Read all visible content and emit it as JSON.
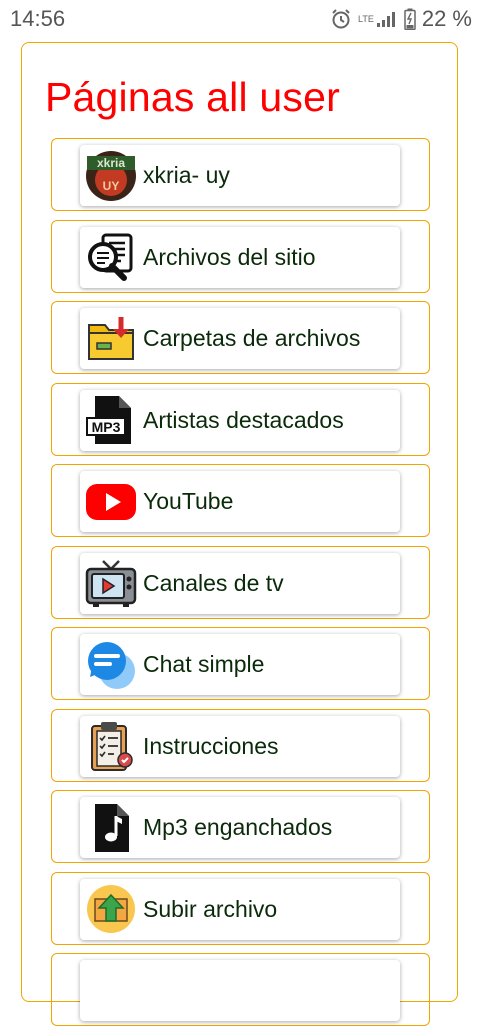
{
  "status_bar": {
    "time": "14:56",
    "network": "LTE",
    "battery": "22 %"
  },
  "page_title": "Páginas all user",
  "menu": [
    {
      "label": "xkria- uy",
      "icon": "xkria-logo-icon"
    },
    {
      "label": "Archivos del sitio",
      "icon": "file-search-icon"
    },
    {
      "label": "Carpetas de archivos",
      "icon": "folder-download-icon"
    },
    {
      "label": "Artistas destacados",
      "icon": "mp3-file-icon"
    },
    {
      "label": "YouTube",
      "icon": "youtube-icon"
    },
    {
      "label": "Canales de tv",
      "icon": "tv-icon"
    },
    {
      "label": "Chat simple",
      "icon": "chat-bubble-icon"
    },
    {
      "label": "Instrucciones",
      "icon": "clipboard-checklist-icon"
    },
    {
      "label": "Mp3 enganchados",
      "icon": "music-note-icon"
    },
    {
      "label": "Subir archivo",
      "icon": "upload-icon"
    }
  ]
}
